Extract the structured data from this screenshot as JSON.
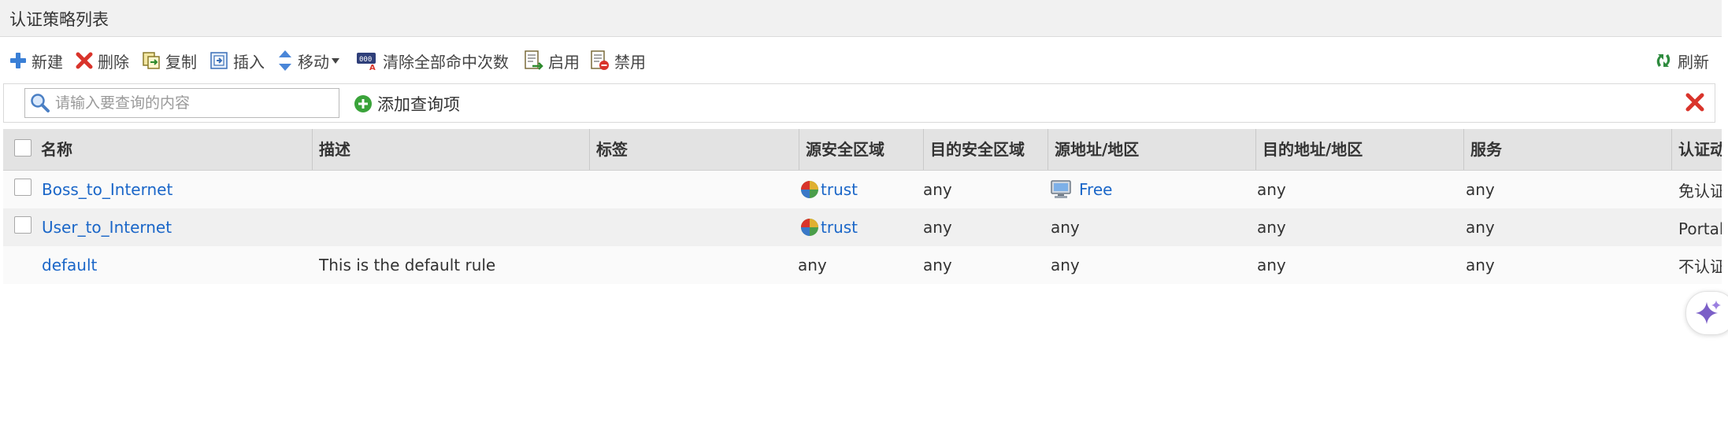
{
  "panel": {
    "title": "认证策略列表"
  },
  "toolbar": {
    "new_label": "新建",
    "delete_label": "删除",
    "copy_label": "复制",
    "insert_label": "插入",
    "move_label": "移动",
    "clear_hits_label": "清除全部命中次数",
    "enable_label": "启用",
    "disable_label": "禁用",
    "refresh_label": "刷新"
  },
  "search": {
    "placeholder": "请输入要查询的内容",
    "value": "",
    "add_query_label": "添加查询项"
  },
  "table": {
    "columns": {
      "name": "名称",
      "desc": "描述",
      "tag": "标签",
      "src_zone": "源安全区域",
      "dst_zone": "目的安全区域",
      "src_addr": "源地址/地区",
      "dst_addr": "目的地址/地区",
      "service": "服务",
      "auth": "认证动作"
    },
    "rows": [
      {
        "name": "Boss_to_Internet",
        "desc": "",
        "tag": "",
        "src_zone": "trust",
        "dst_zone": "any",
        "src_addr": "Free",
        "dst_addr": "any",
        "service": "any",
        "auth": "免认证"
      },
      {
        "name": "User_to_Internet",
        "desc": "",
        "tag": "",
        "src_zone": "trust",
        "dst_zone": "any",
        "src_addr": "any",
        "dst_addr": "any",
        "service": "any",
        "auth": "Portal认证"
      },
      {
        "name": "default",
        "desc": "This is the default rule",
        "tag": "",
        "src_zone": "any",
        "dst_zone": "any",
        "src_addr": "any",
        "dst_addr": "any",
        "service": "any",
        "auth": "不认证"
      }
    ]
  },
  "icons": {
    "new": "plus-icon",
    "delete": "red-x-icon",
    "copy": "copy-icon",
    "insert": "insert-icon",
    "move": "up-down-arrows-icon",
    "clear_hits": "counter-reset-icon",
    "enable": "enable-doc-icon",
    "disable": "disable-doc-icon",
    "refresh": "refresh-icon",
    "search": "magnifier-icon",
    "add_query": "green-plus-circle-icon",
    "close": "red-x-icon",
    "zone": "zone-pie-icon",
    "address": "monitor-icon",
    "assistant": "sparkle-icon"
  },
  "colors": {
    "link": "#1a66c8",
    "header_bg": "#e3e3e3",
    "title_bg": "#f1f1f1",
    "delete_red": "#d9342b",
    "add_green": "#3aa33a"
  }
}
